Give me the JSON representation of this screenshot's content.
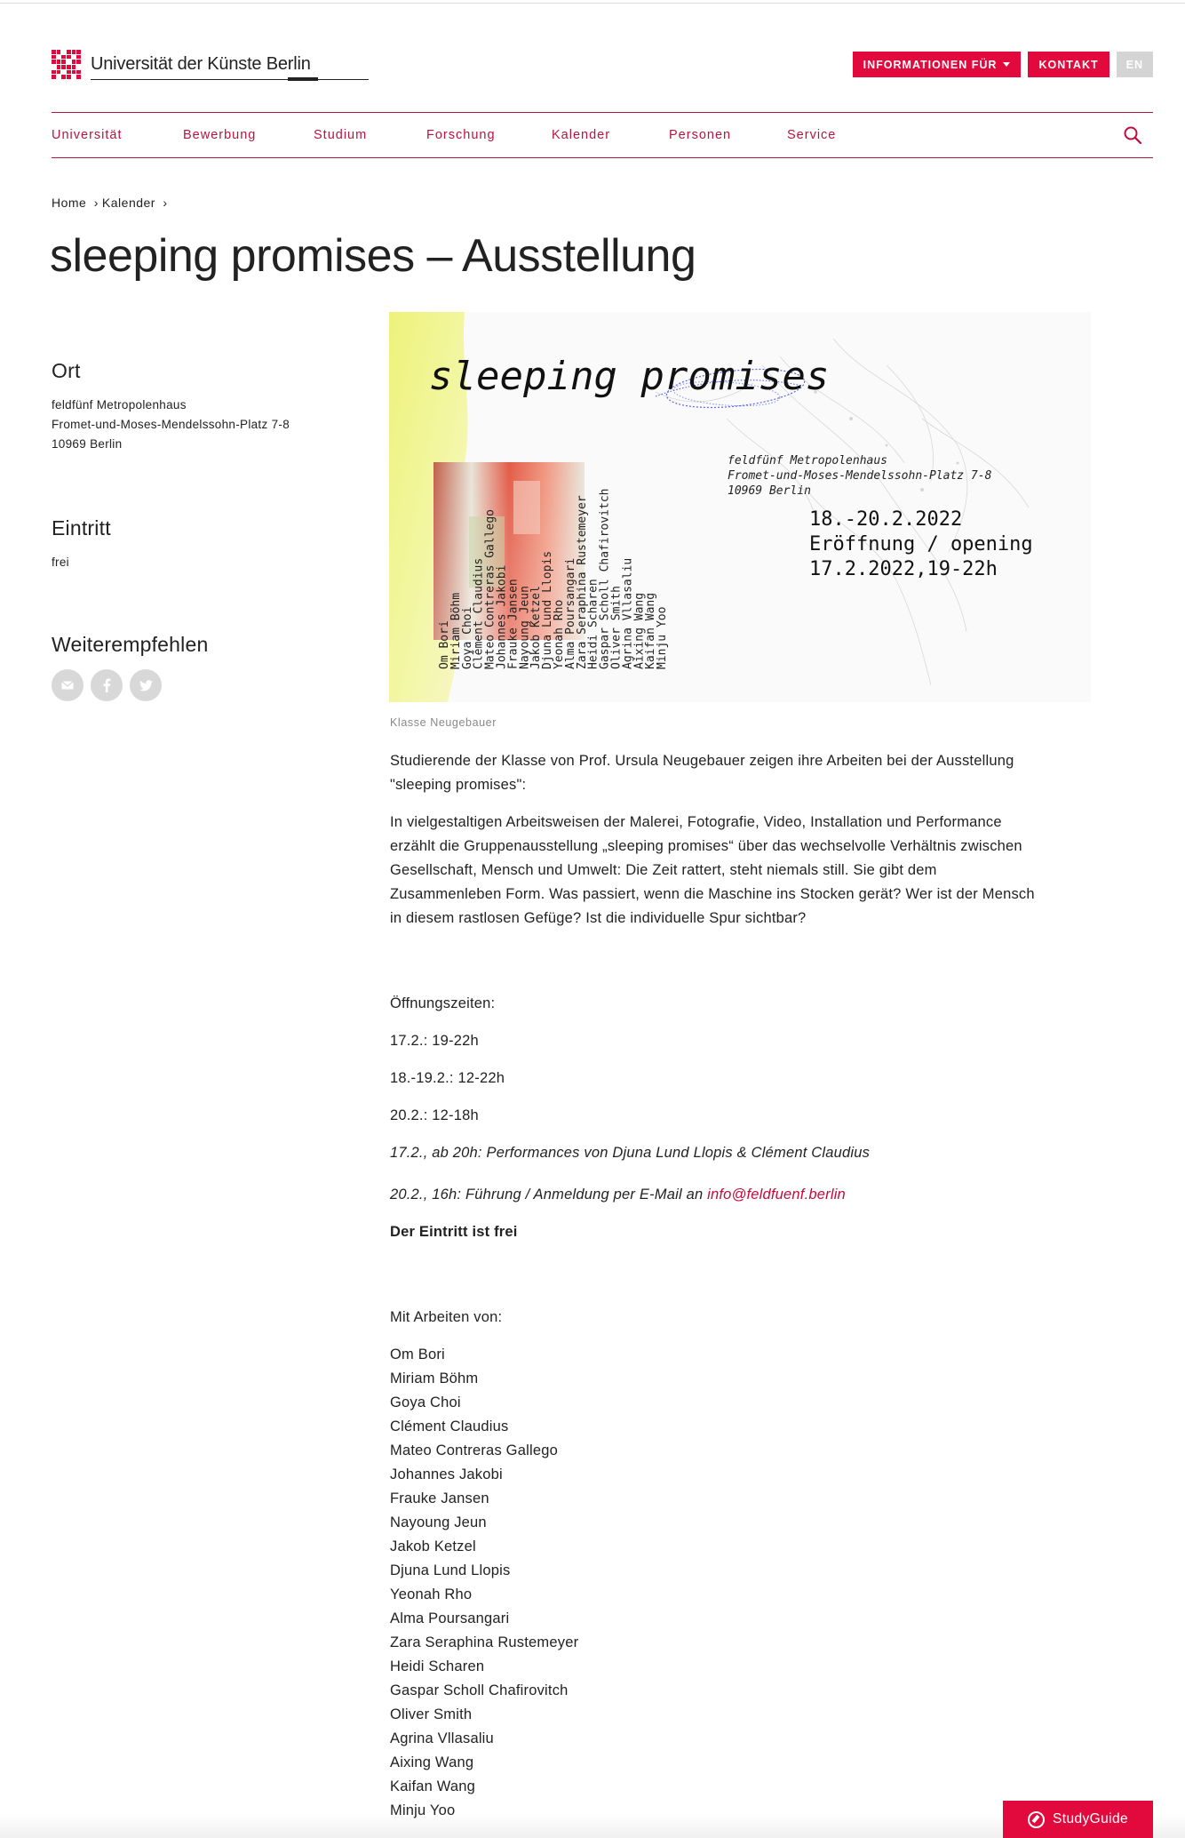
{
  "header": {
    "logo_text": "Universität der Künste Berlin",
    "info_button": "INFORMATIONEN FÜR",
    "contact_button": "KONTAKT",
    "lang_button": "EN"
  },
  "nav": {
    "items": [
      "Universität",
      "Bewerbung",
      "Studium",
      "Forschung",
      "Kalender",
      "Personen",
      "Service"
    ]
  },
  "breadcrumb": {
    "home": "Home",
    "sep1": "›",
    "kalender": "Kalender",
    "sep2": "›"
  },
  "page_title": "sleeping promises – Ausstellung",
  "sidebar": {
    "ort_heading": "Ort",
    "ort_lines": [
      "feldfünf Metropolenhaus",
      "Fromet-und-Moses-Mendelssohn-Platz 7-8",
      "10969 Berlin"
    ],
    "eintritt_heading": "Eintritt",
    "eintritt_value": "frei",
    "share_heading": "Weiterempfehlen",
    "share_icons": [
      "mail-icon",
      "facebook-icon",
      "twitter-icon"
    ]
  },
  "poster": {
    "title": "sleeping promises",
    "venue_lines": [
      "feldfünf Metropolenhaus",
      "Fromet-und-Moses-Mendelssohn-Platz 7-8",
      "10969 Berlin"
    ],
    "date_lines": [
      "18.-20.2.2022",
      "Eröffnung / opening",
      "17.2.2022,19-22h"
    ],
    "names": [
      "Om Bori",
      "Miriam Böhm",
      "Goya Choi",
      "Clément Claudius",
      "Mateo Contreras Gallego",
      "Johannes Jakobi",
      "Frauke Jansen",
      "Nayoung Jeun",
      "Jakob Ketzel",
      "Djuna Lund Llopis",
      "Yeonah Rho",
      "Alma Poursangari",
      "Zara Seraphina Rustemeyer",
      "Heidi Scharen",
      "Gaspar Scholl Chafirovitch",
      "Oliver Smith",
      "Agrina Vllasaliu",
      "Aixing Wang",
      "Kaifan Wang",
      "Minju Yoo"
    ]
  },
  "caption": "Klasse Neugebauer",
  "content": {
    "intro": "Studierende der Klasse von Prof. Ursula Neugebauer zeigen ihre Arbeiten bei der Ausstellung \"sleeping promises\":",
    "description": "In vielgestaltigen Arbeitsweisen der Malerei, Fotografie, Video, Installation und Performance erzählt die Gruppenausstellung „sleeping promises“ über das wechselvolle Verhältnis zwischen Gesellschaft, Mensch und Umwelt: Die Zeit rattert, steht niemals still. Sie gibt dem Zusammenleben Form. Was passiert, wenn die Maschine ins Stocken gerät? Wer ist der Mensch in diesem rastlosen Gefüge? Ist die individuelle Spur sichtbar?",
    "hours_heading": "Öffnungszeiten:",
    "hours": [
      "17.2.: 19-22h",
      "18.-19.2.: 12-22h",
      "20.2.: 12-18h"
    ],
    "performances": "17.2., ab 20h: Performances von Djuna Lund Llopis & Clément Claudius",
    "tour_text": "20.2., 16h: Führung / Anmeldung per E-Mail an ",
    "tour_email": "info@feldfuenf.berlin",
    "free_entry": "Der Eintritt ist frei",
    "works_heading": "Mit Arbeiten von:",
    "artists": [
      "Om Bori",
      "Miriam Böhm",
      "Goya Choi",
      "Clément Claudius",
      "Mateo Contreras Gallego",
      "Johannes Jakobi",
      "Frauke Jansen",
      "Nayoung Jeun",
      "Jakob Ketzel",
      "Djuna Lund Llopis",
      "Yeonah Rho",
      "Alma Poursangari",
      "Zara Seraphina Rustemeyer",
      "Heidi Scharen",
      "Gaspar Scholl Chafirovitch",
      "Oliver Smith",
      "Agrina Vllasaliu",
      "Aixing Wang",
      "Kaifan Wang",
      "Minju Yoo"
    ]
  },
  "studyguide": {
    "label": "StudyGuide"
  },
  "colors": {
    "accent": "#e20a3c",
    "nav": "#b5163f",
    "link": "#c50a3a"
  }
}
